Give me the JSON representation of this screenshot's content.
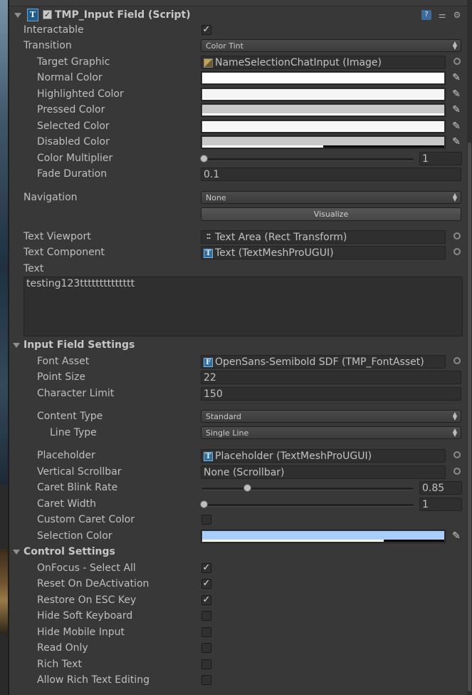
{
  "header": {
    "title": "TMP_Input Field (Script)",
    "enabled": true,
    "icons": [
      "help-icon",
      "presets-icon",
      "settings-gear-icon"
    ]
  },
  "interactable": {
    "label": "Interactable",
    "checked": true
  },
  "transition": {
    "label": "Transition",
    "value": "Color Tint"
  },
  "target_graphic": {
    "label": "Target Graphic",
    "value": "NameSelectionChatInput (Image)"
  },
  "colors": {
    "normal": {
      "label": "Normal Color",
      "hex": "#ffffff",
      "alpha": 1.0
    },
    "highlighted": {
      "label": "Highlighted Color",
      "hex": "#f5f5f5",
      "alpha": 1.0
    },
    "pressed": {
      "label": "Pressed Color",
      "hex": "#c8c8c8",
      "alpha": 1.0
    },
    "selected": {
      "label": "Selected Color",
      "hex": "#f5f5f5",
      "alpha": 1.0
    },
    "disabled": {
      "label": "Disabled Color",
      "hex": "#c8c8c8",
      "alpha": 0.5
    }
  },
  "color_multiplier": {
    "label": "Color Multiplier",
    "value": "1",
    "slider_fraction": 0.0
  },
  "fade_duration": {
    "label": "Fade Duration",
    "value": "0.1"
  },
  "navigation": {
    "label": "Navigation",
    "value": "None",
    "visualize_label": "Visualize"
  },
  "text_viewport": {
    "label": "Text Viewport",
    "value": "Text Area (Rect Transform)"
  },
  "text_component": {
    "label": "Text Component",
    "value": "Text (TextMeshProUGUI)"
  },
  "text": {
    "label": "Text",
    "value": "testing123tttttttttttttt"
  },
  "input_field_settings": {
    "section_title": "Input Field Settings",
    "font_asset": {
      "label": "Font Asset",
      "value": "OpenSans-Semibold SDF (TMP_FontAsset)"
    },
    "point_size": {
      "label": "Point Size",
      "value": "22"
    },
    "character_limit": {
      "label": "Character Limit",
      "value": "150"
    },
    "content_type": {
      "label": "Content Type",
      "value": "Standard"
    },
    "line_type": {
      "label": "Line Type",
      "value": "Single Line"
    },
    "placeholder": {
      "label": "Placeholder",
      "value": "Placeholder (TextMeshProUGUI)"
    },
    "vertical_scrollbar": {
      "label": "Vertical Scrollbar",
      "value": "None (Scrollbar)"
    },
    "caret_blink_rate": {
      "label": "Caret Blink Rate",
      "value": "0.85",
      "slider_fraction": 0.21
    },
    "caret_width": {
      "label": "Caret Width",
      "value": "1",
      "slider_fraction": 0.0
    },
    "custom_caret_color": {
      "label": "Custom Caret Color",
      "checked": false
    },
    "selection_color": {
      "label": "Selection Color",
      "hex": "#a8ceff",
      "alpha": 0.75
    }
  },
  "control_settings": {
    "section_title": "Control Settings",
    "items": [
      {
        "label": "OnFocus - Select All",
        "checked": true
      },
      {
        "label": "Reset On DeActivation",
        "checked": true
      },
      {
        "label": "Restore On ESC Key",
        "checked": true
      },
      {
        "label": "Hide Soft Keyboard",
        "checked": false
      },
      {
        "label": "Hide Mobile Input",
        "checked": false
      },
      {
        "label": "Read Only",
        "checked": false
      },
      {
        "label": "Rich Text",
        "checked": false
      },
      {
        "label": "Allow Rich Text Editing",
        "checked": false
      }
    ]
  }
}
